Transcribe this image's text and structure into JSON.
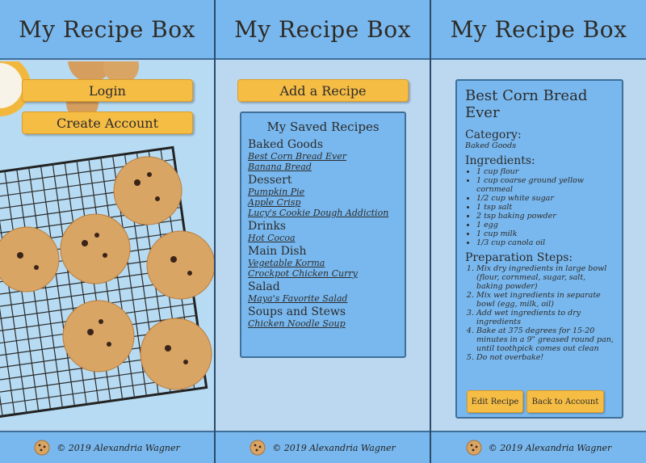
{
  "app": {
    "title": "My Recipe Box",
    "footer": "© 2019 Alexandria Wagner"
  },
  "login_screen": {
    "login_label": "Login",
    "create_account_label": "Create Account"
  },
  "recipes_screen": {
    "add_recipe_label": "Add a Recipe",
    "saved_title": "My Saved Recipes",
    "categories": [
      {
        "name": "Baked Goods",
        "recipes": [
          "Best Corn Bread Ever",
          "Banana Bread"
        ]
      },
      {
        "name": "Dessert",
        "recipes": [
          "Pumpkin Pie",
          "Apple Crisp",
          "Lucy's Cookie Dough Addiction"
        ]
      },
      {
        "name": "Drinks",
        "recipes": [
          "Hot Cocoa"
        ]
      },
      {
        "name": "Main Dish",
        "recipes": [
          "Vegetable Korma",
          "Crockpot Chicken Curry"
        ]
      },
      {
        "name": "Salad",
        "recipes": [
          "Maya's Favorite Salad"
        ]
      },
      {
        "name": "Soups and Stews",
        "recipes": [
          "Chicken Noodle Soup"
        ]
      }
    ]
  },
  "detail_screen": {
    "title": "Best Corn Bread Ever",
    "category_heading": "Category:",
    "category": "Baked Goods",
    "ingredients_heading": "Ingredients:",
    "ingredients": [
      "1 cup flour",
      "1 cup coarse ground yellow cornmeal",
      "1/2 cup white sugar",
      "1 tsp salt",
      "2 tsp baking powder",
      "1 egg",
      "1 cup milk",
      "1/3 cup canola oil"
    ],
    "steps_heading": "Preparation Steps:",
    "steps": [
      "Mix dry ingredients in large bowl (flour, cornmeal, sugar, salt, baking powder)",
      "Mix wet ingredients in separate bowl (egg, milk, oil)",
      "Add wet ingredients to dry ingredients",
      "Bake at 375 degrees for 15-20 minutes in a 9\" greased round pan, until toothpick comes out clean",
      "Do not overbake!"
    ],
    "edit_label": "Edit Recipe",
    "back_label": "Back to Account"
  },
  "colors": {
    "header": "#79b8ee",
    "panel_bg": "#bcd8f1",
    "button": "#f6bd45",
    "border": "#3f6f98"
  }
}
